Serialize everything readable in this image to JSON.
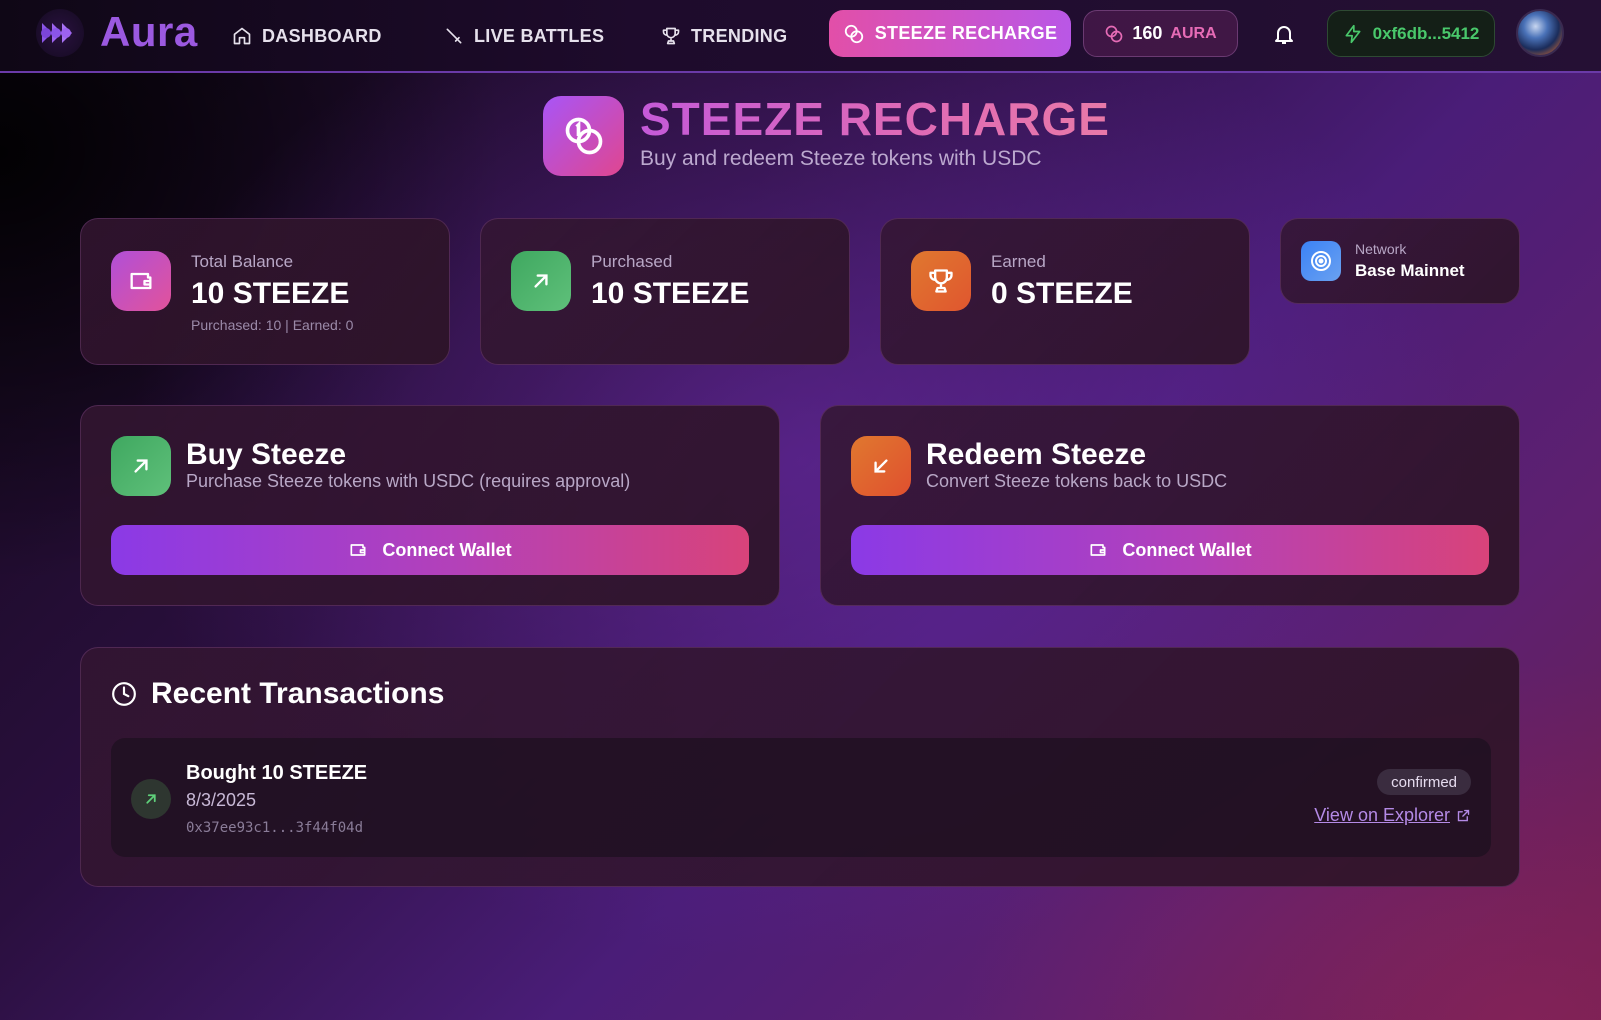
{
  "nav": {
    "brand": "Aura",
    "items": [
      {
        "label": "DASHBOARD",
        "icon": "home-icon"
      },
      {
        "label": "LIVE BATTLES",
        "icon": "sword-icon"
      },
      {
        "label": "TRENDING",
        "icon": "trophy-icon"
      }
    ],
    "active": {
      "label": "STEEZE RECHARGE",
      "icon": "coins-icon"
    },
    "aura_balance": "160",
    "aura_unit": "AURA",
    "wallet": "0xf6db...5412"
  },
  "header": {
    "title": "STEEZE RECHARGE",
    "subtitle": "Buy and redeem Steeze tokens with USDC"
  },
  "stats": {
    "total": {
      "label": "Total Balance",
      "value": "10 STEEZE",
      "note": "Purchased: 10 | Earned: 0"
    },
    "purchased": {
      "label": "Purchased",
      "value": "10 STEEZE"
    },
    "earned": {
      "label": "Earned",
      "value": "0 STEEZE"
    },
    "network": {
      "label": "Network",
      "value": "Base Mainnet"
    }
  },
  "buy": {
    "title": "Buy Steeze",
    "subtitle": "Purchase Steeze tokens with USDC (requires approval)",
    "button": "Connect Wallet"
  },
  "redeem": {
    "title": "Redeem Steeze",
    "subtitle": "Convert Steeze tokens back to USDC",
    "button": "Connect Wallet"
  },
  "transactions": {
    "title": "Recent Transactions",
    "items": [
      {
        "name": "Bought 10 STEEZE",
        "date": "8/3/2025",
        "hash": "0x37ee93c1...3f44f04d",
        "status": "confirmed",
        "link": "View on Explorer"
      }
    ]
  },
  "colors": {
    "accent_pink": "#e24fa8",
    "accent_purple": "#9b59e0",
    "wallet_green": "#49c86b",
    "buy_green": "#4caf6a",
    "redeem_orange": "#e0562f"
  }
}
